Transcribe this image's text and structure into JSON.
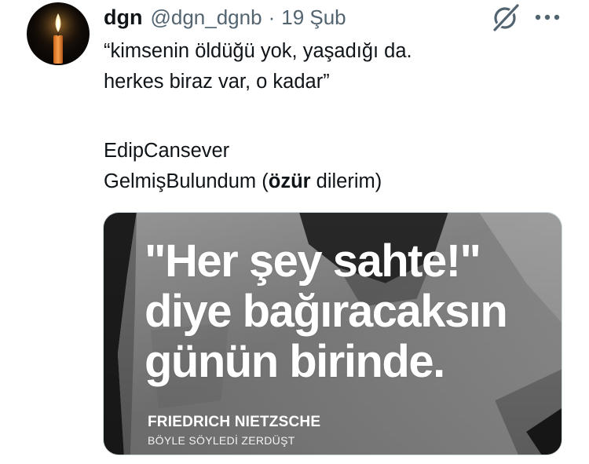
{
  "tweet": {
    "user": {
      "display_name": "dgn",
      "handle": "@dgn_dgnb",
      "avatar_icon": "candle-icon"
    },
    "separator": "·",
    "date": "19 Şub",
    "actions": {
      "grok_icon": "grok-icon",
      "more_icon": "more-icon"
    },
    "text": {
      "line1": "“kimsenin öldüğü yok, yaşadığı da.",
      "line2": "herkes biraz var, o kadar”",
      "line3": "EdipCansever",
      "line4_before": "GelmişBulundum (",
      "line4_bold": "özür",
      "line4_after": " dilerim)"
    },
    "media": {
      "quote_line1": "\"Her şey sahte!\"",
      "quote_line2": "diye bağıracaksın",
      "quote_line3": "günün birinde.",
      "author": "FRIEDRICH NIETZSCHE",
      "book": "BÖYLE SÖYLEDİ ZERDÜŞT"
    }
  },
  "colors": {
    "text": "#0f1419",
    "secondary": "#536471",
    "border": "#cfd9de"
  }
}
